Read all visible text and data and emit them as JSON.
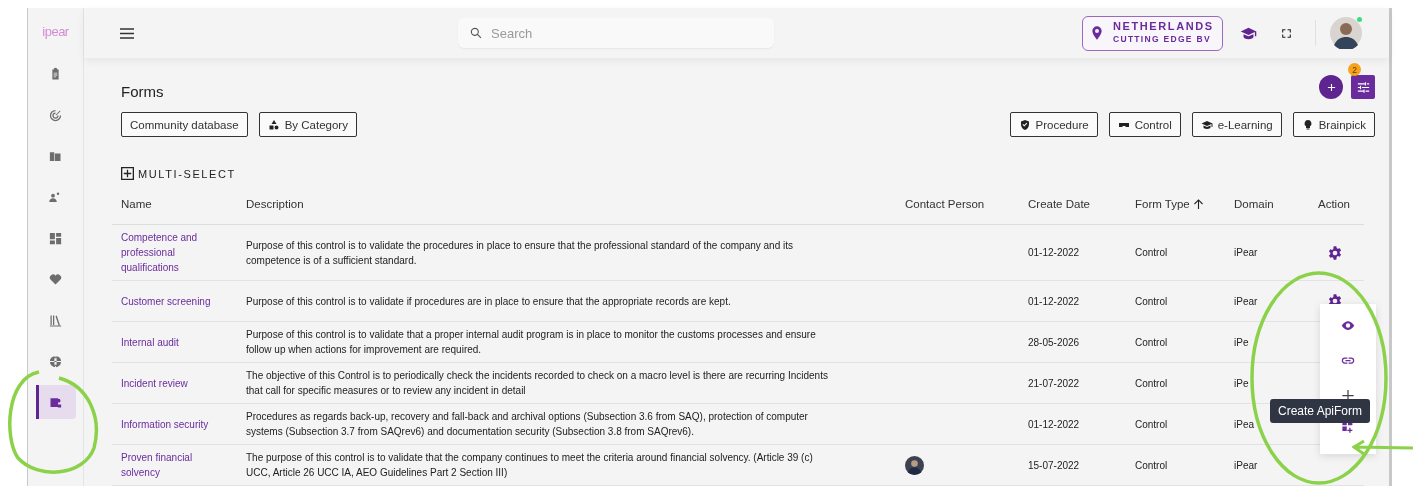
{
  "sidebar": {
    "logo": "ipear",
    "items": [
      {
        "selected": false
      },
      {
        "selected": false
      },
      {
        "selected": false
      },
      {
        "selected": false
      },
      {
        "selected": false
      },
      {
        "selected": false
      },
      {
        "selected": false
      },
      {
        "selected": false
      },
      {
        "selected": true
      }
    ]
  },
  "topbar": {
    "search": {
      "placeholder": "Search"
    },
    "location": {
      "country": "NETHERLANDS",
      "company": "CUTTING EDGE BV"
    },
    "user_online": true
  },
  "page": {
    "title": "Forms",
    "filter_badge": "2",
    "left_filters": [
      "Community database",
      "By Category"
    ],
    "type_filters": [
      "Procedure",
      "Control",
      "e-Learning",
      "Brainpick"
    ],
    "multi_select": "MULTI-SELECT"
  },
  "table": {
    "columns": [
      {
        "label": "Name",
        "sorted": false
      },
      {
        "label": "Description",
        "sorted": false
      },
      {
        "label": "Contact Person",
        "sorted": false
      },
      {
        "label": "Create Date",
        "sorted": false
      },
      {
        "label": "Form Type",
        "sorted": true
      },
      {
        "label": "Domain",
        "sorted": false
      },
      {
        "label": "Action",
        "sorted": false
      }
    ],
    "rows": [
      {
        "name": "Competence and professional qualifications",
        "description": "Purpose of this control is to validate the procedures in place to ensure that the professional standard of the company and its competence is of a sufficient standard.",
        "has_contact": false,
        "create_date": "01-12-2022",
        "form_type": "Control",
        "domain": "iPear",
        "settings_visible": true
      },
      {
        "name": "Customer screening",
        "description": "Purpose of this control is to validate if procedures are in place to ensure that the appropriate records are kept.",
        "has_contact": false,
        "create_date": "01-12-2022",
        "form_type": "Control",
        "domain": "iPear",
        "settings_visible": true
      },
      {
        "name": "Internal audit",
        "description": "Purpose of this control is to validate that a proper internal audit program is in place to monitor the customs processes and ensure follow up when actions for improvement are required.",
        "has_contact": false,
        "create_date": "28-05-2026",
        "form_type": "Control",
        "domain": "iPe",
        "settings_visible": false
      },
      {
        "name": "Incident review",
        "description": "The objective of this Control is to periodically check the incidents recorded to check on a macro level is there are recurring Incidents that call for specific measures or to review any incident in detail",
        "has_contact": false,
        "create_date": "21-07-2022",
        "form_type": "Control",
        "domain": "iPe",
        "settings_visible": false
      },
      {
        "name": "Information security",
        "description": "Procedures as regards back-up, recovery and fall-back and archival options (Subsection 3.6 from SAQ), protection of computer systems (Subsection 3.7 from SAQrev6) and documentation security (Subsection 3.8 from SAQrev6).",
        "has_contact": false,
        "create_date": "01-12-2022",
        "form_type": "Control",
        "domain": "iPea",
        "settings_visible": false
      },
      {
        "name": "Proven financial solvency",
        "description": "The purpose of this control is to validate that the company continues to meet the criteria around financial solvency. (Article 39 (c) UCC, Article 26 UCC IA, AEO Guidelines Part 2 Section III)",
        "has_contact": true,
        "create_date": "15-07-2022",
        "form_type": "Control",
        "domain": "iPear",
        "settings_visible": false
      }
    ]
  },
  "action_menu": {
    "tooltip": "Create ApiForm"
  }
}
